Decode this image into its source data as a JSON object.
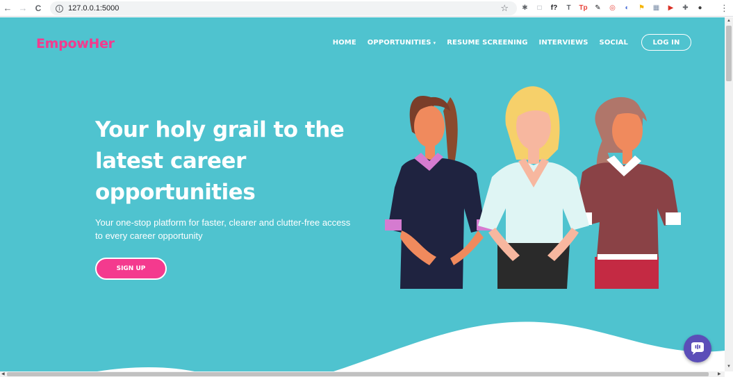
{
  "browser": {
    "url": "127.0.0.1:5000",
    "back_icon": "←",
    "forward_icon": "→",
    "reload_icon": "C",
    "star_icon": "☆",
    "menu_icon": "⋮",
    "extensions": [
      {
        "icon": "bug-icon",
        "glyph": "✱",
        "color": "#5f6368"
      },
      {
        "icon": "square-icon",
        "glyph": "□",
        "color": "#9aa0a6"
      },
      {
        "icon": "formula-icon",
        "glyph": "f?",
        "color": "#202124"
      },
      {
        "icon": "tt-icon",
        "glyph": "T",
        "color": "#5f6368"
      },
      {
        "icon": "tp-icon",
        "glyph": "Tp",
        "color": "#e8453c"
      },
      {
        "icon": "pen-icon",
        "glyph": "✎",
        "color": "#202124"
      },
      {
        "icon": "chrome-icon",
        "glyph": "◎",
        "color": "#e8453c"
      },
      {
        "icon": "compass-icon",
        "glyph": "◐",
        "color": "#4a6fd8"
      },
      {
        "icon": "flag-icon",
        "glyph": "⚑",
        "color": "#f5b400"
      },
      {
        "icon": "grid-icon",
        "glyph": "▦",
        "color": "#7c8fa8"
      },
      {
        "icon": "video-icon",
        "glyph": "▶",
        "color": "#d93025"
      },
      {
        "icon": "puzzle-icon",
        "glyph": "✚",
        "color": "#5f6368"
      },
      {
        "icon": "avatar-icon",
        "glyph": "●",
        "color": "#3c3c3c"
      }
    ]
  },
  "header": {
    "brand": "EmpowHer",
    "nav": {
      "home": "HOME",
      "opportunities": "OPPORTUNITIES",
      "opportunities_caret": "▾",
      "resume": "RESUME SCREENING",
      "interviews": "INTERVIEWS",
      "social": "SOCIAL",
      "login": "LOG IN"
    }
  },
  "hero": {
    "title": "Your holy grail to the latest career opportunities",
    "subtitle": "Your one-stop platform for faster, clearer and clutter-free access to every career opportunity",
    "cta": "SIGN UP"
  },
  "colors": {
    "background": "#4fc3cf",
    "brand": "#f43a8e",
    "chat": "#5b4eb8"
  },
  "chat_widget": {
    "icon": "chat-bubble-icon"
  }
}
